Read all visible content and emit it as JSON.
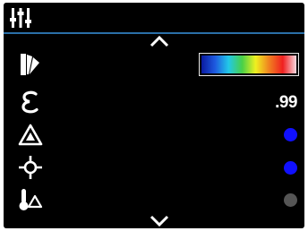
{
  "header": {
    "icon": "sliders-icon"
  },
  "nav": {
    "up_icon": "chevron-up-icon",
    "down_icon": "chevron-down-icon"
  },
  "rows": [
    {
      "id": "palette",
      "icon": "palette-icon",
      "value_type": "gradient",
      "gradient": [
        "#0a1aa0",
        "#1e5ae0",
        "#22c8e8",
        "#48d048",
        "#f0f020",
        "#f08020",
        "#f02020",
        "#f8d8e0"
      ]
    },
    {
      "id": "emissivity",
      "icon": "epsilon-icon",
      "value": ".99"
    },
    {
      "id": "alarm",
      "icon": "warning-triangle-icon",
      "indicator_color": "#1010ff",
      "state": "on"
    },
    {
      "id": "crosshair",
      "icon": "crosshair-icon",
      "indicator_color": "#1010ff",
      "state": "on"
    },
    {
      "id": "temperature-alarm",
      "icon": "thermometer-triangle-icon",
      "indicator_color": "#555555",
      "state": "off"
    }
  ]
}
